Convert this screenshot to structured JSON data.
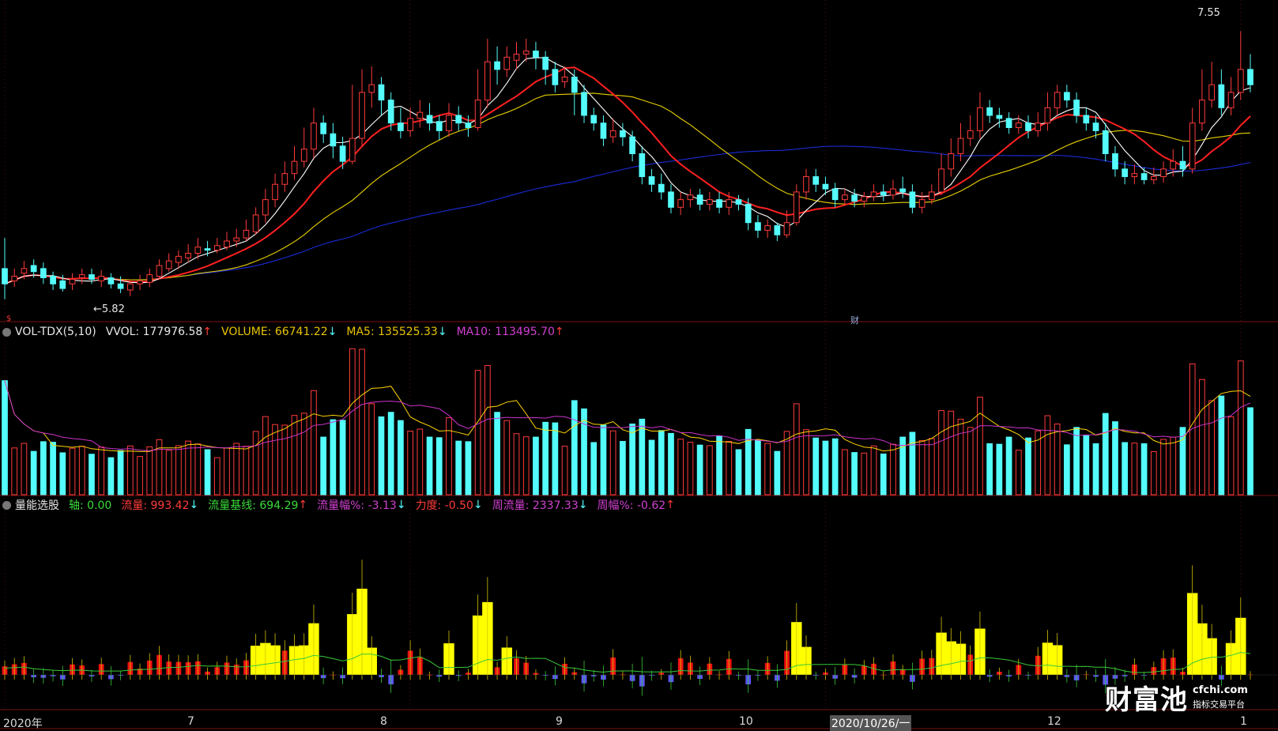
{
  "price_panel": {
    "high_annotation": "7.55",
    "low_annotation": "←5.82",
    "marker_text": "财",
    "corner_mark": "$"
  },
  "vol_header": {
    "name": "VOL-TDX(5,10)",
    "vvol": "VVOL: 177976.58",
    "vvol_arrow": "↑",
    "volume": "VOLUME: 66741.22",
    "volume_arrow": "↓",
    "ma5": "MA5: 135525.33",
    "ma5_arrow": "↓",
    "ma10": "MA10: 113495.70",
    "ma10_arrow": "↑"
  },
  "flow_header": {
    "name": "量能选股",
    "axis": "轴: 0.00",
    "flow": "流量: 993.42",
    "flow_arrow": "↓",
    "baseline": "流量基线: 694.29",
    "baseline_arrow": "↑",
    "flow_pct": "流量幅%: -3.13",
    "flow_pct_arrow": "↓",
    "strength": "力度: -0.50",
    "strength_arrow": "↓",
    "weekly_flow": "周流量: 2337.33",
    "weekly_flow_arrow": "↓",
    "weekly_pct": "周幅%: -0.62",
    "weekly_pct_arrow": "↑"
  },
  "x_axis": {
    "labels": [
      "2020年",
      "7",
      "8",
      "9",
      "10",
      "2020/10/26/一",
      "12",
      "1"
    ]
  },
  "watermark": {
    "brand": "财富池",
    "url": "cfchi.com",
    "tagline": "指标交易平台"
  },
  "colors": {
    "up": "#ff3b3b",
    "down": "#54fcfc",
    "ma5": "#ffffff",
    "ma10": "#ff2020",
    "ma20": "#e8d000",
    "ma60": "#1a2bd6",
    "vol_ma5": "#ffd400",
    "vol_ma10": "#cc33cc",
    "flow_pos": "#ee1111",
    "flow_neg": "#5a55f5",
    "flow_hi": "#ffff00",
    "flow_line": "#39c939"
  },
  "chart_data": {
    "type": "candlestick",
    "price_range": [
      5.7,
      7.65
    ],
    "high": 7.55,
    "low": 5.82,
    "bars": [
      [
        6.0,
        5.9,
        6.2,
        5.8
      ],
      [
        5.92,
        5.95,
        6.0,
        5.88
      ],
      [
        5.97,
        6.0,
        6.05,
        5.93
      ],
      [
        6.02,
        5.98,
        6.06,
        5.94
      ],
      [
        6.0,
        5.94,
        6.04,
        5.9
      ],
      [
        5.95,
        5.9,
        5.98,
        5.86
      ],
      [
        5.92,
        5.87,
        5.96,
        5.85
      ],
      [
        5.9,
        5.93,
        5.97,
        5.86
      ],
      [
        5.94,
        5.96,
        6.0,
        5.9
      ],
      [
        5.96,
        5.93,
        6.0,
        5.9
      ],
      [
        5.92,
        5.95,
        5.99,
        5.88
      ],
      [
        5.94,
        5.9,
        5.97,
        5.87
      ],
      [
        5.9,
        5.87,
        5.95,
        5.84
      ],
      [
        5.86,
        5.9,
        5.93,
        5.82
      ],
      [
        5.9,
        5.92,
        5.96,
        5.86
      ],
      [
        5.91,
        5.96,
        6.0,
        5.88
      ],
      [
        5.95,
        6.02,
        6.06,
        5.93
      ],
      [
        6.0,
        6.05,
        6.1,
        5.98
      ],
      [
        6.04,
        6.08,
        6.12,
        6.0
      ],
      [
        6.07,
        6.1,
        6.16,
        6.04
      ],
      [
        6.1,
        6.14,
        6.2,
        6.06
      ],
      [
        6.13,
        6.12,
        6.18,
        6.08
      ],
      [
        6.12,
        6.15,
        6.2,
        6.1
      ],
      [
        6.14,
        6.18,
        6.24,
        6.12
      ],
      [
        6.18,
        6.2,
        6.26,
        6.14
      ],
      [
        6.2,
        6.25,
        6.32,
        6.18
      ],
      [
        6.24,
        6.35,
        6.4,
        6.22
      ],
      [
        6.35,
        6.45,
        6.52,
        6.3
      ],
      [
        6.45,
        6.55,
        6.62,
        6.4
      ],
      [
        6.55,
        6.62,
        6.7,
        6.5
      ],
      [
        6.62,
        6.7,
        6.8,
        6.58
      ],
      [
        6.7,
        6.78,
        6.92,
        6.66
      ],
      [
        6.78,
        6.95,
        7.05,
        6.72
      ],
      [
        6.95,
        6.88,
        7.0,
        6.82
      ],
      [
        6.88,
        6.8,
        6.95,
        6.72
      ],
      [
        6.8,
        6.7,
        6.86,
        6.65
      ],
      [
        6.7,
        6.85,
        7.2,
        6.68
      ],
      [
        6.85,
        7.15,
        7.3,
        6.8
      ],
      [
        7.15,
        7.2,
        7.32,
        7.05
      ],
      [
        7.2,
        7.1,
        7.25,
        7.0
      ],
      [
        7.1,
        6.95,
        7.15,
        6.9
      ],
      [
        6.95,
        6.9,
        7.05,
        6.85
      ],
      [
        6.9,
        6.98,
        7.05,
        6.86
      ],
      [
        6.98,
        7.02,
        7.1,
        6.92
      ],
      [
        7.0,
        6.95,
        7.08,
        6.9
      ],
      [
        6.96,
        6.9,
        7.0,
        6.84
      ],
      [
        6.9,
        7.0,
        7.08,
        6.86
      ],
      [
        7.0,
        6.95,
        7.06,
        6.9
      ],
      [
        6.95,
        6.92,
        7.0,
        6.86
      ],
      [
        6.92,
        7.1,
        7.3,
        6.9
      ],
      [
        7.1,
        7.35,
        7.5,
        7.05
      ],
      [
        7.35,
        7.3,
        7.45,
        7.2
      ],
      [
        7.3,
        7.38,
        7.45,
        7.25
      ],
      [
        7.36,
        7.4,
        7.48,
        7.3
      ],
      [
        7.4,
        7.42,
        7.5,
        7.35
      ],
      [
        7.42,
        7.38,
        7.48,
        7.3
      ],
      [
        7.38,
        7.3,
        7.42,
        7.2
      ],
      [
        7.3,
        7.2,
        7.35,
        7.15
      ],
      [
        7.22,
        7.25,
        7.32,
        7.18
      ],
      [
        7.25,
        7.15,
        7.3,
        7.0
      ],
      [
        7.15,
        7.0,
        7.2,
        6.95
      ],
      [
        7.0,
        6.95,
        7.05,
        6.9
      ],
      [
        6.95,
        6.85,
        7.0,
        6.8
      ],
      [
        6.86,
        6.9,
        6.98,
        6.82
      ],
      [
        6.9,
        6.86,
        6.95,
        6.8
      ],
      [
        6.86,
        6.75,
        6.9,
        6.7
      ],
      [
        6.75,
        6.6,
        6.8,
        6.55
      ],
      [
        6.6,
        6.55,
        6.65,
        6.5
      ],
      [
        6.55,
        6.5,
        6.62,
        6.45
      ],
      [
        6.5,
        6.4,
        6.55,
        6.36
      ],
      [
        6.4,
        6.45,
        6.5,
        6.35
      ],
      [
        6.45,
        6.48,
        6.52,
        6.4
      ],
      [
        6.48,
        6.42,
        6.52,
        6.38
      ],
      [
        6.42,
        6.45,
        6.5,
        6.38
      ],
      [
        6.45,
        6.4,
        6.5,
        6.36
      ],
      [
        6.4,
        6.45,
        6.5,
        6.35
      ],
      [
        6.45,
        6.42,
        6.48,
        6.38
      ],
      [
        6.42,
        6.3,
        6.46,
        6.25
      ],
      [
        6.3,
        6.25,
        6.35,
        6.2
      ],
      [
        6.25,
        6.28,
        6.32,
        6.2
      ],
      [
        6.28,
        6.22,
        6.3,
        6.18
      ],
      [
        6.22,
        6.3,
        6.38,
        6.2
      ],
      [
        6.3,
        6.5,
        6.55,
        6.28
      ],
      [
        6.5,
        6.6,
        6.65,
        6.45
      ],
      [
        6.6,
        6.55,
        6.65,
        6.5
      ],
      [
        6.55,
        6.52,
        6.6,
        6.48
      ],
      [
        6.52,
        6.45,
        6.56,
        6.4
      ],
      [
        6.45,
        6.48,
        6.52,
        6.42
      ],
      [
        6.48,
        6.44,
        6.52,
        6.4
      ],
      [
        6.44,
        6.47,
        6.5,
        6.4
      ],
      [
        6.47,
        6.5,
        6.55,
        6.44
      ],
      [
        6.5,
        6.48,
        6.55,
        6.44
      ],
      [
        6.48,
        6.52,
        6.58,
        6.45
      ],
      [
        6.52,
        6.5,
        6.6,
        6.46
      ],
      [
        6.5,
        6.4,
        6.55,
        6.36
      ],
      [
        6.4,
        6.45,
        6.5,
        6.36
      ],
      [
        6.45,
        6.5,
        6.55,
        6.42
      ],
      [
        6.5,
        6.65,
        6.75,
        6.48
      ],
      [
        6.65,
        6.75,
        6.85,
        6.6
      ],
      [
        6.75,
        6.85,
        6.95,
        6.7
      ],
      [
        6.85,
        6.9,
        7.0,
        6.8
      ],
      [
        6.9,
        7.05,
        7.15,
        6.85
      ],
      [
        7.05,
        7.0,
        7.1,
        6.95
      ],
      [
        7.0,
        6.98,
        7.05,
        6.92
      ],
      [
        6.98,
        6.92,
        7.02,
        6.88
      ],
      [
        6.92,
        6.95,
        7.0,
        6.88
      ],
      [
        6.95,
        6.9,
        7.0,
        6.85
      ],
      [
        6.9,
        6.95,
        7.02,
        6.86
      ],
      [
        6.95,
        7.05,
        7.15,
        6.9
      ],
      [
        7.05,
        7.15,
        7.2,
        7.0
      ],
      [
        7.15,
        7.1,
        7.2,
        7.05
      ],
      [
        7.1,
        7.0,
        7.15,
        6.95
      ],
      [
        7.0,
        6.95,
        7.05,
        6.9
      ],
      [
        6.95,
        6.9,
        7.0,
        6.85
      ],
      [
        6.9,
        6.75,
        6.95,
        6.7
      ],
      [
        6.75,
        6.65,
        6.8,
        6.6
      ],
      [
        6.65,
        6.6,
        6.7,
        6.55
      ],
      [
        6.6,
        6.62,
        6.68,
        6.55
      ],
      [
        6.62,
        6.58,
        6.66,
        6.55
      ],
      [
        6.58,
        6.6,
        6.66,
        6.55
      ],
      [
        6.6,
        6.65,
        6.7,
        6.56
      ],
      [
        6.65,
        6.7,
        6.78,
        6.6
      ],
      [
        6.7,
        6.65,
        6.8,
        6.6
      ],
      [
        6.65,
        6.95,
        7.05,
        6.62
      ],
      [
        6.95,
        7.1,
        7.3,
        6.9
      ],
      [
        7.1,
        7.2,
        7.35,
        7.05
      ],
      [
        7.2,
        7.05,
        7.3,
        7.0
      ],
      [
        7.05,
        7.15,
        7.25,
        7.0
      ],
      [
        7.15,
        7.3,
        7.55,
        7.1
      ],
      [
        7.3,
        7.2,
        7.4,
        7.15
      ]
    ]
  }
}
